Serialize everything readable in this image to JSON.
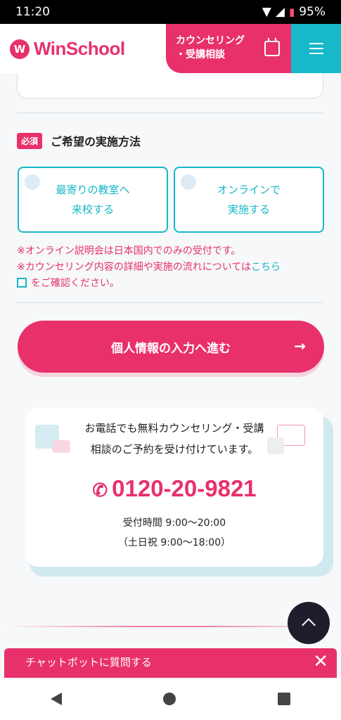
{
  "status": {
    "time": "11:20",
    "battery": "95%"
  },
  "header": {
    "logo_mark": "W",
    "logo_text": "WinSchool",
    "counsel_line1": "カウンセリング",
    "counsel_line2": "・受講相談"
  },
  "method": {
    "required_badge": "必須",
    "title": "ご希望の実施方法",
    "options": [
      {
        "line1": "最寄りの教室へ",
        "line2": "来校する"
      },
      {
        "line1": "オンラインで",
        "line2": "実施する"
      }
    ],
    "note1": "※オンライン説明会は日本国内でのみの受付です。",
    "note2_pre": "※カウンセリング内容の詳細や実施の流れについては",
    "note2_link": "こちら",
    "note2_post": "をご確認ください。"
  },
  "next_button": {
    "label": "個人情報の入力へ進む",
    "arrow": "→"
  },
  "phone": {
    "text_line1": "お電話でも無料カウンセリング・受講",
    "text_line2": "相談のご予約を受け付けています。",
    "number": "0120-20-9821",
    "hours_line1": "受付時間 9:00〜20:00",
    "hours_line2": "（土日祝 9:00〜18:00）"
  },
  "chatbot": {
    "label": "チャットボットに質問する",
    "close": "✕"
  },
  "colors": {
    "brand_pink": "#e8306a",
    "accent_teal": "#16b8c9"
  },
  "icons": [
    "wifi-icon",
    "signal-icon",
    "battery-icon",
    "calendar-edit-icon",
    "hamburger-menu-icon",
    "external-link-icon",
    "arrow-right-icon",
    "phone-icon",
    "chevron-up-icon",
    "close-icon"
  ]
}
